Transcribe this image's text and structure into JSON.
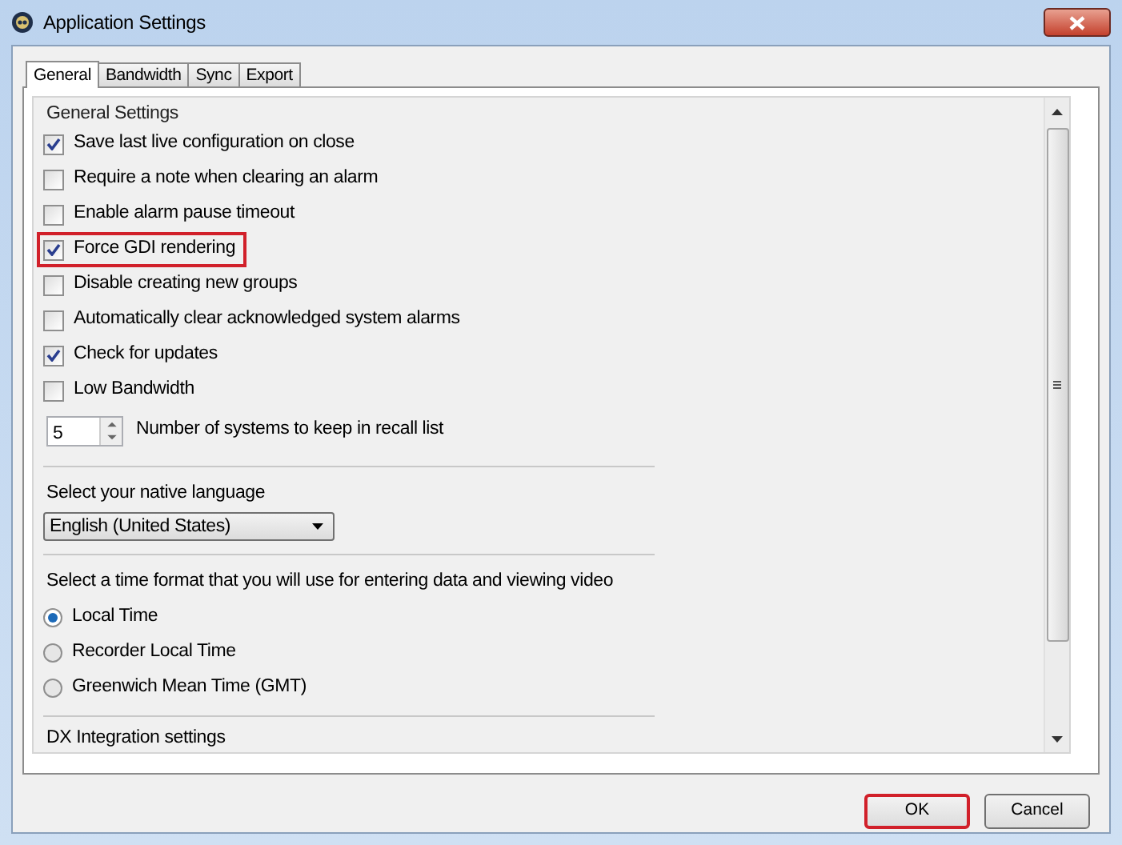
{
  "window": {
    "title": "Application Settings"
  },
  "tabs": [
    {
      "label": "General",
      "selected": true
    },
    {
      "label": "Bandwidth",
      "selected": false
    },
    {
      "label": "Sync",
      "selected": false
    },
    {
      "label": "Export",
      "selected": false
    }
  ],
  "group_title": "General Settings",
  "options": [
    {
      "label": "Save last live configuration on close",
      "checked": true,
      "highlighted": false
    },
    {
      "label": "Require a note when clearing an alarm",
      "checked": false,
      "highlighted": false
    },
    {
      "label": "Enable alarm pause timeout",
      "checked": false,
      "highlighted": false
    },
    {
      "label": "Force GDI rendering",
      "checked": true,
      "highlighted": true
    },
    {
      "label": "Disable creating new groups",
      "checked": false,
      "highlighted": false
    },
    {
      "label": "Automatically clear acknowledged system alarms",
      "checked": false,
      "highlighted": false
    },
    {
      "label": "Check for updates",
      "checked": true,
      "highlighted": false
    },
    {
      "label": "Low Bandwidth",
      "checked": false,
      "highlighted": false
    }
  ],
  "recall": {
    "value": "5",
    "label": "Number of systems to keep in recall list"
  },
  "language": {
    "label": "Select your native language",
    "value": "English (United States)"
  },
  "time_format": {
    "label": "Select a time format that you will use for entering data and viewing video",
    "options": [
      {
        "label": "Local Time",
        "selected": true
      },
      {
        "label": "Recorder Local Time",
        "selected": false
      },
      {
        "label": "Greenwich Mean Time (GMT)",
        "selected": false
      }
    ]
  },
  "dx_section": {
    "label": "DX Integration settings"
  },
  "buttons": [
    {
      "label": "OK",
      "highlighted": true
    },
    {
      "label": "Cancel",
      "highlighted": false
    }
  ]
}
